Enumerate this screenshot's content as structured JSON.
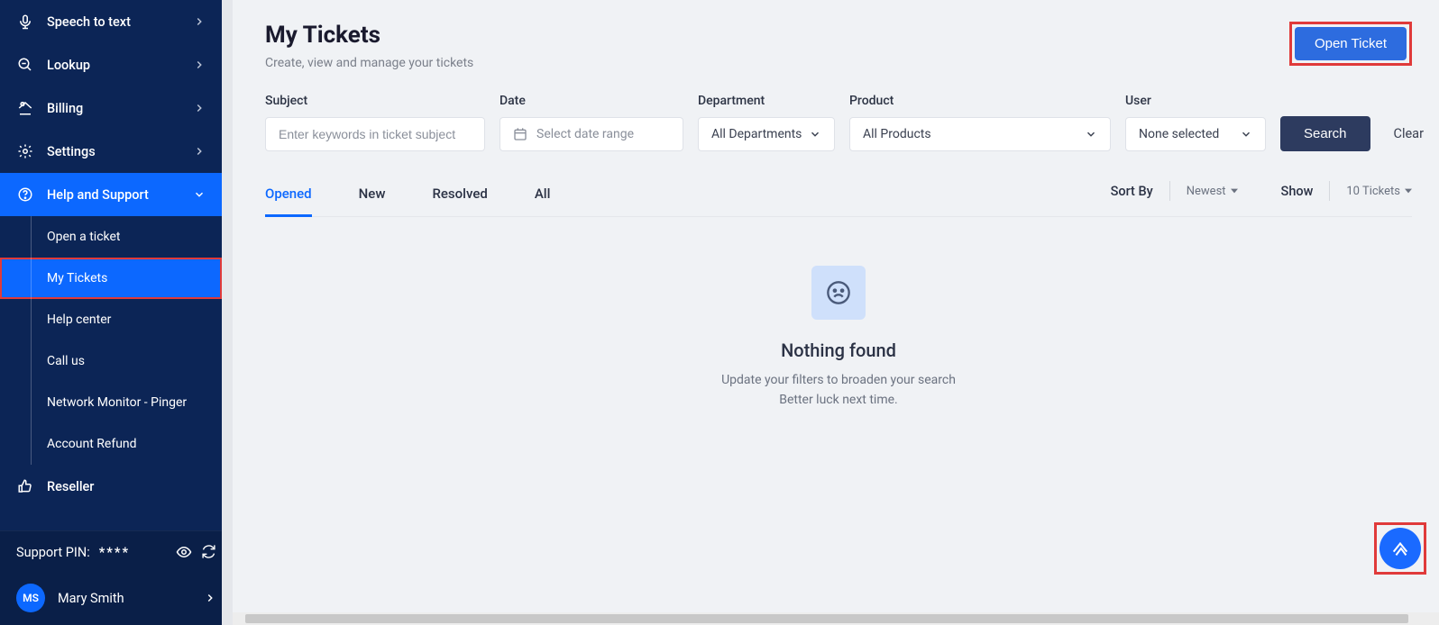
{
  "sidebar": {
    "items": [
      {
        "label": "Speech to text"
      },
      {
        "label": "Lookup"
      },
      {
        "label": "Billing"
      },
      {
        "label": "Settings"
      },
      {
        "label": "Help and Support"
      },
      {
        "label": "Reseller"
      }
    ],
    "sub": [
      {
        "label": "Open a ticket"
      },
      {
        "label": "My Tickets"
      },
      {
        "label": "Help center"
      },
      {
        "label": "Call us"
      },
      {
        "label": "Network Monitor - Pinger"
      },
      {
        "label": "Account Refund"
      }
    ],
    "pin_label": "Support PIN:",
    "pin_value": "****",
    "user": {
      "initials": "MS",
      "name": "Mary Smith"
    }
  },
  "page": {
    "title": "My Tickets",
    "subtitle": "Create, view and manage your tickets",
    "open_ticket": "Open Ticket"
  },
  "filters": {
    "subject": {
      "label": "Subject",
      "placeholder": "Enter keywords in ticket subject"
    },
    "date": {
      "label": "Date",
      "placeholder": "Select date range"
    },
    "department": {
      "label": "Department",
      "value": "All Departments"
    },
    "product": {
      "label": "Product",
      "value": "All Products"
    },
    "user": {
      "label": "User",
      "value": "None selected"
    },
    "search": "Search",
    "clear": "Clear"
  },
  "tabs": [
    {
      "label": "Opened"
    },
    {
      "label": "New"
    },
    {
      "label": "Resolved"
    },
    {
      "label": "All"
    }
  ],
  "controls": {
    "sortby": "Sort By",
    "sort_value": "Newest",
    "show": "Show",
    "show_value": "10 Tickets"
  },
  "empty": {
    "title": "Nothing found",
    "line1": "Update your filters to broaden your search",
    "line2": "Better luck next time."
  }
}
